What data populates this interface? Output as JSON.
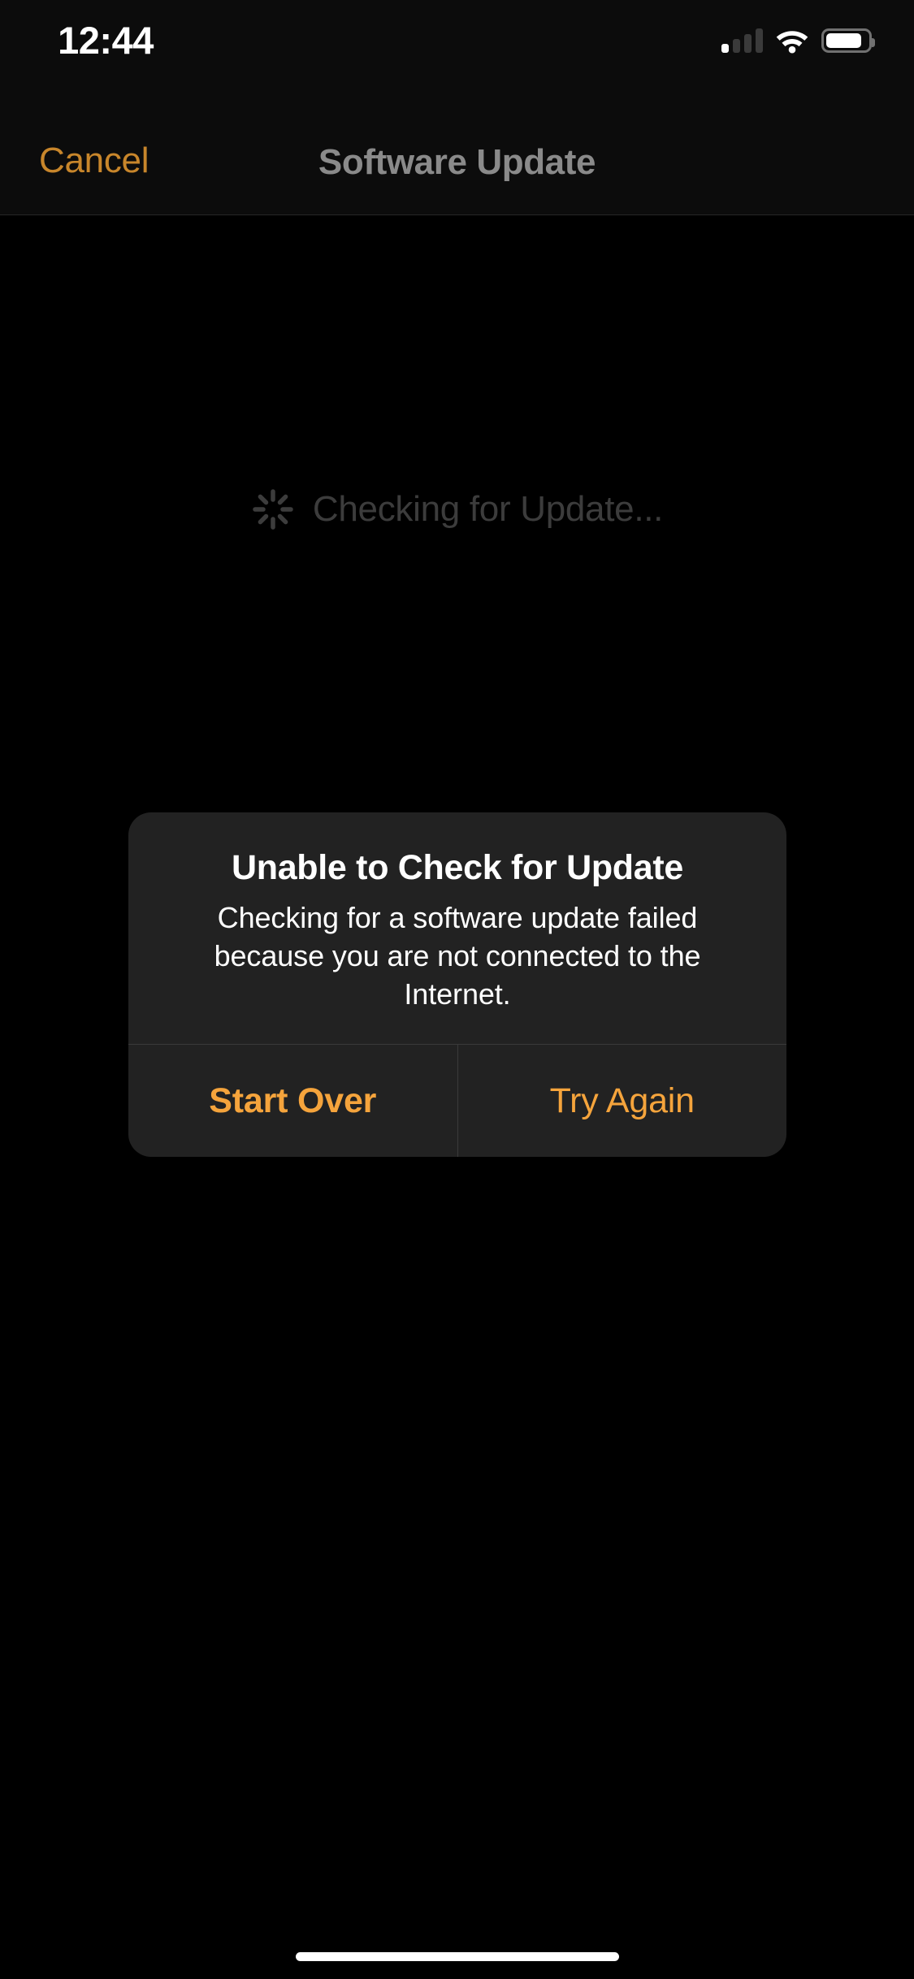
{
  "status_bar": {
    "time": "12:44",
    "cellular": {
      "icon": "signal-bars-icon",
      "bars_total": 4,
      "bars_active": 1
    },
    "wifi": {
      "icon": "wifi-icon",
      "strength": "full"
    },
    "battery": {
      "icon": "battery-icon",
      "level_percent": 76
    }
  },
  "nav_bar": {
    "cancel_label": "Cancel",
    "title": "Software Update"
  },
  "content": {
    "spinner_icon": "activity-spinner-icon",
    "checking_label": "Checking for Update..."
  },
  "alert": {
    "title": "Unable to Check for Update",
    "message": "Checking for a software update failed because you are not connected to the Internet.",
    "actions": [
      {
        "label": "Start Over",
        "style": "primary"
      },
      {
        "label": "Try Again",
        "style": "secondary"
      }
    ]
  },
  "colors": {
    "background": "#000000",
    "bar_background": "#0C0C0C",
    "accent_cancel": "#C8862B",
    "accent_action": "#F5A43C",
    "dialog_background": "#222222",
    "title_gray": "#8A8A8A",
    "checking_gray": "#3C3C3C"
  }
}
